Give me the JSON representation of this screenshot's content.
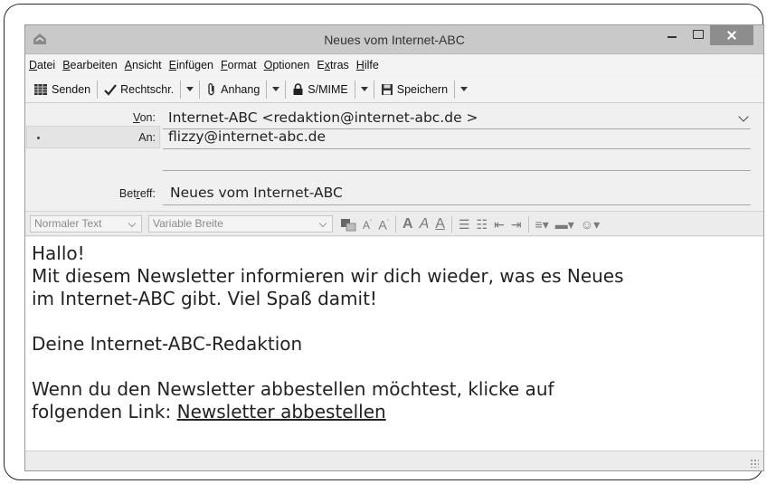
{
  "window": {
    "title": "Neues vom Internet-ABC"
  },
  "menu": {
    "items": [
      {
        "ul": "D",
        "rest": "atei"
      },
      {
        "ul": "B",
        "rest": "earbeiten"
      },
      {
        "ul": "A",
        "rest": "nsicht"
      },
      {
        "ul": "E",
        "rest": "infügen"
      },
      {
        "ul": "F",
        "rest": "ormat"
      },
      {
        "ul": "O",
        "rest": "ptionen"
      },
      {
        "pre": "E",
        "ul": "x",
        "rest": "tras"
      },
      {
        "ul": "H",
        "rest": "ilfe"
      }
    ]
  },
  "toolbar": {
    "send": "Senden",
    "spell": "Rechtschr.",
    "attach": "Anhang",
    "smime": "S/MIME",
    "save": "Speichern"
  },
  "headers": {
    "from_label_ul": "V",
    "from_label_rest": "on:",
    "from_value": "Internet-ABC <redaktion@internet-abc.de >",
    "to_label": "An:",
    "to_value": "flizzy@internet-abc.de",
    "subject_label_pre": "Bet",
    "subject_label_ul": "r",
    "subject_label_rest": "eff:",
    "subject_value": "Neues vom Internet-ABC"
  },
  "format": {
    "paragraph": "Normaler Text",
    "font": "Variable Breite"
  },
  "body": {
    "greeting": "Hallo!",
    "line1": "Mit diesem Newsletter informieren wir dich wieder, was es Neues",
    "line2": "im Internet-ABC gibt. Viel Spaß damit!",
    "signature": "Deine Internet-ABC-Redaktion",
    "unsub_line1": "Wenn du den Newsletter abbestellen möchtest, klicke auf",
    "unsub_prefix": "folgenden Link: ",
    "unsub_link": "Newsletter abbestellen"
  }
}
